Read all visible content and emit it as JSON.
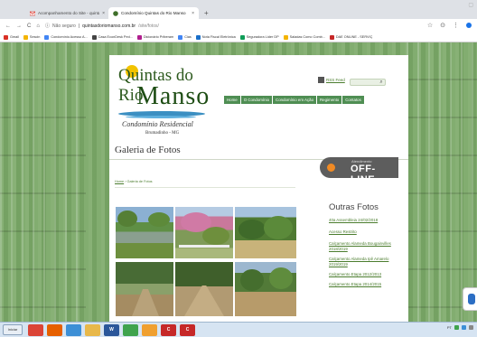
{
  "browser": {
    "tabs": [
      {
        "title": "Acompanhamento do Site - quintas",
        "favicon": "gmail-icon"
      },
      {
        "title": "Condomínio Quintas do Rio Manso",
        "favicon": "site-icon"
      }
    ],
    "address": {
      "security_label": "Não seguro",
      "host": "quintasdoriomanso.com.br",
      "path": "/site/fotos/"
    },
    "bookmarks": [
      {
        "label": "Gmail",
        "color": "#d93025"
      },
      {
        "label": "Sescin",
        "color": "#f4b400"
      },
      {
        "label": "Condomínio Acesso A...",
        "color": "#4285f4"
      },
      {
        "label": "Casa EconDesk Ped...",
        "color": "#444444"
      },
      {
        "label": "Dicionário Priberam",
        "color": "#b01e8e"
      },
      {
        "label": "Cias",
        "color": "#4285f4"
      },
      {
        "label": "Nota Fiscal Eletrônica",
        "color": "#1a6fc9"
      },
      {
        "label": "Seguradora Líder DP",
        "color": "#0f9d58"
      },
      {
        "label": "Saladas Como Comb...",
        "color": "#f4b400"
      },
      {
        "label": "DAE ONLINE - SERVIÇ",
        "color": "#c62828"
      }
    ]
  },
  "site": {
    "logo": {
      "line1": "Quintas do Rio",
      "line2": "Manso",
      "tagline": "Condomínio Residencial",
      "city": "Brumadinho - MG"
    },
    "rss_label": "RSS Feed",
    "search_placeholder": "",
    "nav": [
      "Home",
      "O Condomínio",
      "Condomínio em Ação",
      "Regimento",
      "Contatos"
    ],
    "page_title": "Galeria de Fotos",
    "chat": {
      "small_label": "Atendimento",
      "status": "OFF-LINE"
    },
    "breadcrumb": {
      "home": "Home",
      "separator": " › ",
      "current": "Galeria de Fotos"
    },
    "sidebar": {
      "title": "Outras Fotos",
      "links": [
        "40a Assembleia 24/02/2018",
        "Acesso Restrito",
        "Calçamento Alameda Bougainvilles 2018/2019",
        "Calçamento Alameda Ipê Amarelo 2019/2019",
        "Calçamento Etapa 2012/2013",
        "Calçamento Etapa 2014/2015"
      ]
    }
  },
  "taskbar": {
    "start_label": "Iniciar",
    "apps": [
      {
        "name": "chrome-icon",
        "color": "#db4437",
        "label": ""
      },
      {
        "name": "firefox-icon",
        "color": "#e66000",
        "label": ""
      },
      {
        "name": "media-icon",
        "color": "#3d8fd6",
        "label": ""
      },
      {
        "name": "folder-icon",
        "color": "#e8b84a",
        "label": ""
      },
      {
        "name": "word-icon",
        "color": "#2b579a",
        "label": "W"
      },
      {
        "name": "photos-icon",
        "color": "#3fa34d",
        "label": ""
      },
      {
        "name": "player-icon",
        "color": "#f0a030",
        "label": ""
      },
      {
        "name": "app-red-icon",
        "color": "#c62828",
        "label": "C"
      },
      {
        "name": "app-red2-icon",
        "color": "#c62828",
        "label": "C"
      }
    ],
    "tray_label": "PT"
  }
}
